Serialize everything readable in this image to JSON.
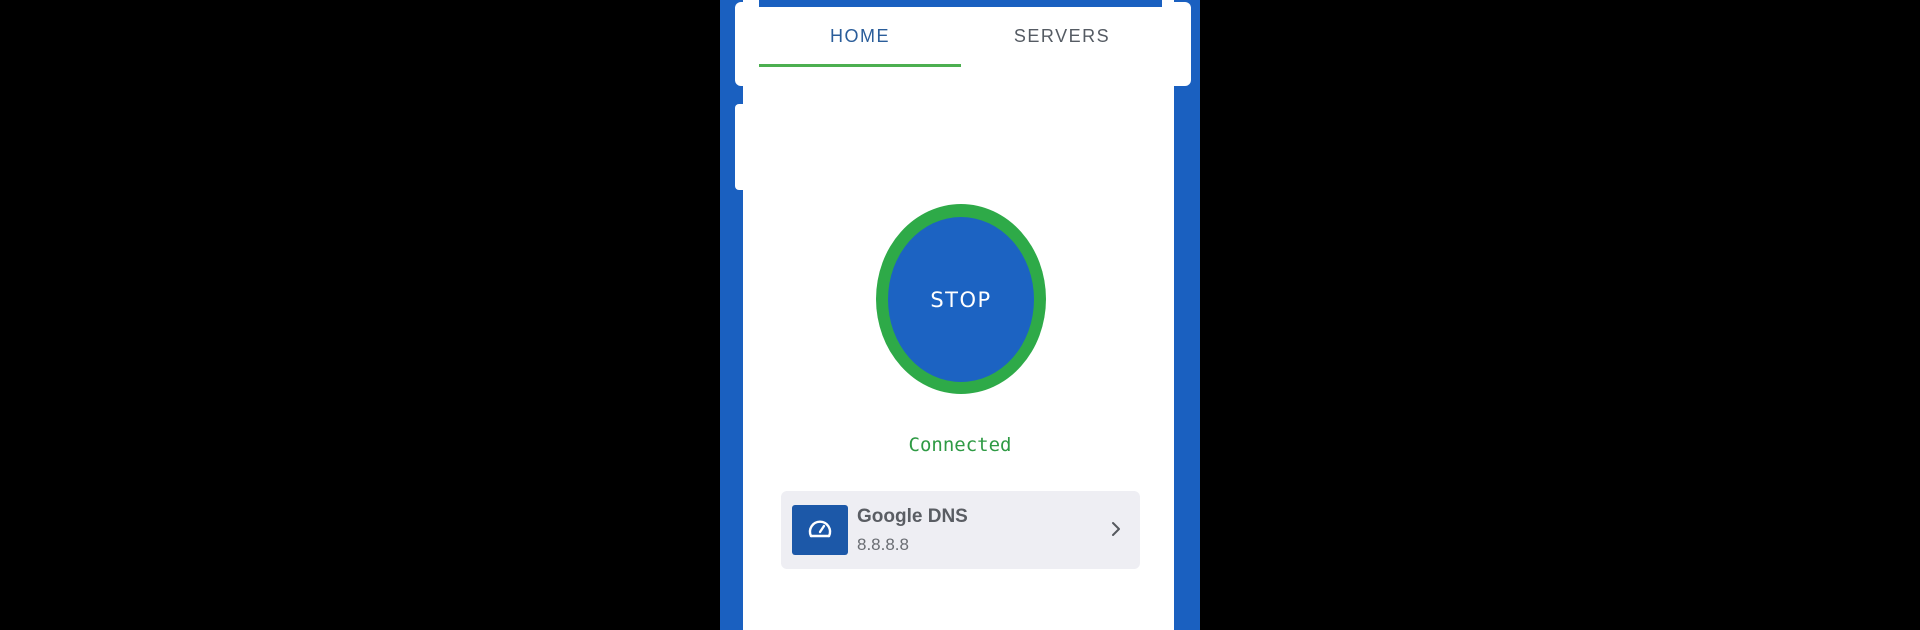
{
  "tabs": [
    {
      "label": "HOME",
      "active": true
    },
    {
      "label": "SERVERS",
      "active": false
    }
  ],
  "control": {
    "button_label": "STOP",
    "status": "Connected"
  },
  "server": {
    "name": "Google DNS",
    "address": "8.8.8.8",
    "icon": "speedometer-icon"
  },
  "colors": {
    "frame": "#1a60c0",
    "accent_green": "#2eaa48",
    "button_blue": "#1c63c2",
    "tab_active_text": "#2a5d9a"
  }
}
